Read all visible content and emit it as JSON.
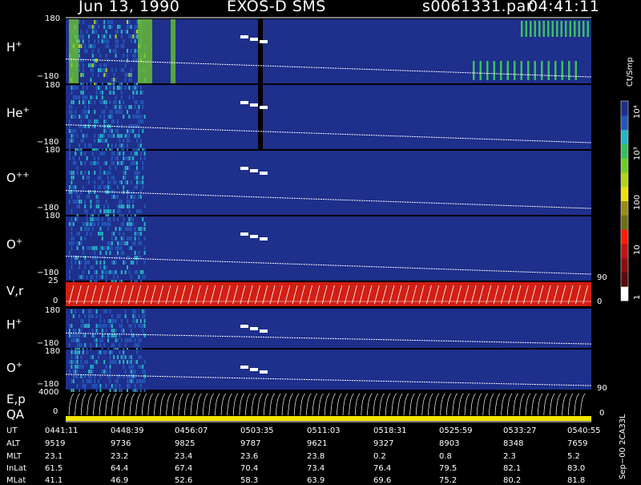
{
  "header": {
    "date": "Jun 13, 1990",
    "instrument": "EXOS-D SMS",
    "file": "s0061331.par",
    "time": "04:41:11"
  },
  "colors": {
    "background": "#000000",
    "panel_base": "#1e2f8c",
    "velocity_bar": "#d11f14",
    "qa_bar": "#f4e400",
    "trace": "#ffffff"
  },
  "colorbar": {
    "label": "Ct/Smp",
    "tick_labels": [
      "1",
      "10",
      "100",
      "10³",
      "10⁴"
    ],
    "colors": [
      "#1e2f8c",
      "#2456b8",
      "#27b4c4",
      "#3bbf5e",
      "#6fcd2a",
      "#b4d21e",
      "#eede10",
      "#9a8a1a",
      "#6f6f14",
      "#ff1a00",
      "#c01414",
      "#8a1010",
      "#5a0a0a",
      "#ffffff"
    ]
  },
  "panels": [
    {
      "id": "h-plus-1",
      "label": "H",
      "sup": "+",
      "top_tick": "180",
      "bottom_tick": "−180"
    },
    {
      "id": "he-plus",
      "label": "He",
      "sup": "+",
      "top_tick": "180",
      "bottom_tick": "−180"
    },
    {
      "id": "o-plus-plus",
      "label": "O",
      "sup": "++",
      "top_tick": "180",
      "bottom_tick": "−180"
    },
    {
      "id": "o-plus-1",
      "label": "O",
      "sup": "+",
      "top_tick": "180",
      "bottom_tick": "−180"
    },
    {
      "id": "vr",
      "label": "V,r",
      "sup": "",
      "top_tick": "25",
      "bottom_tick": "0",
      "right_top": "90",
      "right_bottom": "0"
    },
    {
      "id": "h-plus-2",
      "label": "H",
      "sup": "+",
      "top_tick": "180",
      "bottom_tick": "−180"
    },
    {
      "id": "o-plus-2",
      "label": "O",
      "sup": "+",
      "top_tick": "180",
      "bottom_tick": "−180",
      "right_bottom": "90"
    },
    {
      "id": "ep",
      "label": "E,p",
      "sup": "",
      "top_tick": "4000",
      "bottom_tick": "0"
    },
    {
      "id": "qa",
      "label": "QA",
      "sup": "",
      "top_tick": "",
      "bottom_tick": "",
      "right_top": "0"
    }
  ],
  "right_labels": {
    "lower": "Sep−00 2CA33L"
  },
  "table": {
    "row_labels": [
      "UT",
      "ALT",
      "MLT",
      "InLat",
      "MLat"
    ],
    "columns": [
      [
        "0441:11",
        "9519",
        "23.1",
        "61.5",
        "41.1"
      ],
      [
        "0448:39",
        "9736",
        "23.2",
        "64.4",
        "46.9"
      ],
      [
        "0456:07",
        "9825",
        "23.4",
        "67.4",
        "52.6"
      ],
      [
        "0503:35",
        "9787",
        "23.6",
        "70.4",
        "58.3"
      ],
      [
        "0511:03",
        "9621",
        "23.8",
        "73.4",
        "63.9"
      ],
      [
        "0518:31",
        "9327",
        "0.2",
        "76.4",
        "69.6"
      ],
      [
        "0525:59",
        "8903",
        "0.8",
        "79.5",
        "75.2"
      ],
      [
        "0533:27",
        "8348",
        "2.3",
        "82.1",
        "80.2"
      ],
      [
        "0540:55",
        "7659",
        "5.2",
        "83.0",
        "81.8"
      ]
    ]
  },
  "chart_data": {
    "type": "heatmap",
    "title": "Jun 13, 1990   EXOS-D SMS",
    "x": {
      "label": "UT",
      "ticks": [
        "0441:11",
        "0448:39",
        "0456:07",
        "0503:35",
        "0511:03",
        "0518:31",
        "0525:59",
        "0533:27",
        "0540:55"
      ],
      "range": [
        "0441:11",
        "0540:55"
      ]
    },
    "colorscale": {
      "label": "Ct/Smp",
      "scale": "log",
      "range": [
        1,
        10000
      ]
    },
    "panels": [
      {
        "name": "H+",
        "y_range": [
          -180,
          180
        ]
      },
      {
        "name": "He+",
        "y_range": [
          -180,
          180
        ]
      },
      {
        "name": "O++",
        "y_range": [
          -180,
          180
        ]
      },
      {
        "name": "O+",
        "y_range": [
          -180,
          180
        ]
      },
      {
        "name": "V,r",
        "y_range": [
          0,
          25
        ],
        "right_axis": [
          0,
          90
        ]
      },
      {
        "name": "H+",
        "y_range": [
          -180,
          180
        ]
      },
      {
        "name": "O+",
        "y_range": [
          -180,
          180
        ],
        "right_axis": [
          90
        ]
      },
      {
        "name": "E,p",
        "y_range": [
          0,
          4000
        ]
      },
      {
        "name": "QA"
      }
    ],
    "ephemeris": {
      "UT": [
        "0441:11",
        "0448:39",
        "0456:07",
        "0503:35",
        "0511:03",
        "0518:31",
        "0525:59",
        "0533:27",
        "0540:55"
      ],
      "ALT": [
        9519,
        9736,
        9825,
        9787,
        9621,
        9327,
        8903,
        8348,
        7659
      ],
      "MLT": [
        23.1,
        23.2,
        23.4,
        23.6,
        23.8,
        0.2,
        0.8,
        2.3,
        5.2
      ],
      "InLat": [
        61.5,
        64.4,
        67.4,
        70.4,
        73.4,
        76.4,
        79.5,
        82.1,
        83.0
      ],
      "MLat": [
        41.1,
        46.9,
        52.6,
        58.3,
        63.9,
        69.6,
        75.2,
        80.2,
        81.8
      ]
    }
  }
}
